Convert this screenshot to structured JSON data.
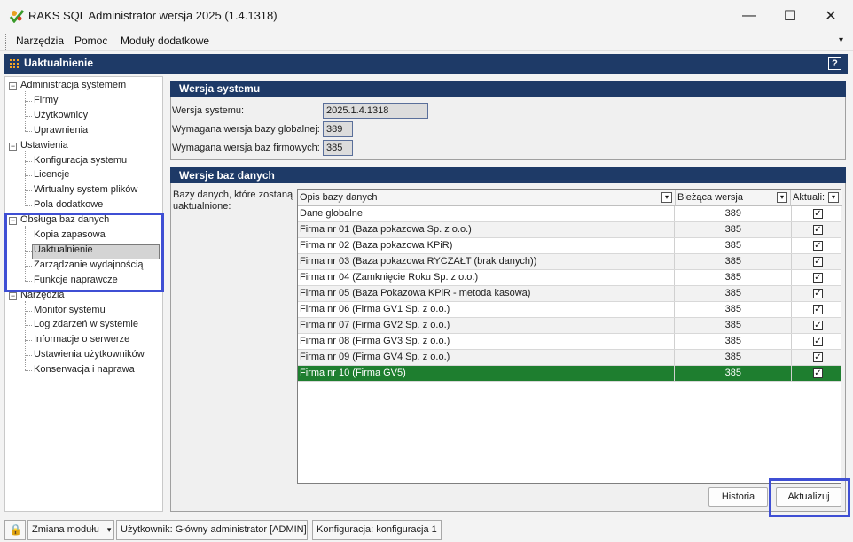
{
  "window": {
    "title": "RAKS SQL Administrator wersja 2025 (1.4.1318)",
    "minimize": "—",
    "maximize": "☐",
    "close": "✕"
  },
  "menu": {
    "items": [
      "Narzędzia",
      "Pomoc",
      "Moduły dodatkowe"
    ],
    "overflow": "▾"
  },
  "header": {
    "title": "Uaktualnienie",
    "help": "?"
  },
  "tree": [
    {
      "label": "Administracja systemem",
      "level": 0,
      "expander": "−"
    },
    {
      "label": "Firmy",
      "level": 1
    },
    {
      "label": "Użytkownicy",
      "level": 1
    },
    {
      "label": "Uprawnienia",
      "level": 1
    },
    {
      "label": "Ustawienia",
      "level": 0,
      "expander": "−"
    },
    {
      "label": "Konfiguracja systemu",
      "level": 1
    },
    {
      "label": "Licencje",
      "level": 1
    },
    {
      "label": "Wirtualny system plików",
      "level": 1
    },
    {
      "label": "Pola dodatkowe",
      "level": 1
    },
    {
      "label": "Obsługa baz danych",
      "level": 0,
      "expander": "−"
    },
    {
      "label": "Kopia zapasowa",
      "level": 1
    },
    {
      "label": "Uaktualnienie",
      "level": 1,
      "selected": true
    },
    {
      "label": "Zarządzanie wydajnością",
      "level": 1
    },
    {
      "label": "Funkcje naprawcze",
      "level": 1
    },
    {
      "label": "Narzędzia",
      "level": 0,
      "expander": "−"
    },
    {
      "label": "Monitor systemu",
      "level": 1
    },
    {
      "label": "Log zdarzeń w systemie",
      "level": 1
    },
    {
      "label": "Informacje o serwerze",
      "level": 1
    },
    {
      "label": "Ustawienia użytkowników",
      "level": 1
    },
    {
      "label": "Konserwacja i naprawa",
      "level": 1
    }
  ],
  "system_version": {
    "section_title": "Wersja systemu",
    "version_label": "Wersja systemu:",
    "version_value": "2025.1.4.1318",
    "global_label": "Wymagana wersja bazy globalnej:",
    "global_value": "389",
    "company_label": "Wymagana wersja baz firmowych:",
    "company_value": "385"
  },
  "databases": {
    "section_title": "Wersje baz danych",
    "intro": "Bazy danych, które zostaną uaktualnione:",
    "columns": [
      "Opis bazy danych",
      "Bieżąca wersja",
      "Aktuali:"
    ],
    "rows": [
      {
        "name": "Dane globalne",
        "version": "389",
        "checked": true
      },
      {
        "name": "Firma nr 01 (Baza pokazowa Sp. z o.o.)",
        "version": "385",
        "checked": true
      },
      {
        "name": "Firma nr 02 (Baza pokazowa KPiR)",
        "version": "385",
        "checked": true
      },
      {
        "name": "Firma nr 03 (Baza pokazowa RYCZAŁT (brak danych))",
        "version": "385",
        "checked": true
      },
      {
        "name": "Firma nr 04 (Zamknięcie Roku Sp. z o.o.)",
        "version": "385",
        "checked": true
      },
      {
        "name": "Firma nr 05 (Baza Pokazowa KPiR - metoda kasowa)",
        "version": "385",
        "checked": true
      },
      {
        "name": "Firma nr 06 (Firma GV1 Sp. z o.o.)",
        "version": "385",
        "checked": true
      },
      {
        "name": "Firma nr 07 (Firma GV2 Sp. z o.o.)",
        "version": "385",
        "checked": true
      },
      {
        "name": "Firma nr 08 (Firma GV3 Sp. z o.o.)",
        "version": "385",
        "checked": true
      },
      {
        "name": "Firma nr 09 (Firma GV4 Sp. z o.o.)",
        "version": "385",
        "checked": true
      },
      {
        "name": "Firma nr 10 (Firma GV5)",
        "version": "385",
        "checked": true,
        "selected": true
      }
    ],
    "check_mark": "✓",
    "dropdown_glyph": "▾"
  },
  "buttons": {
    "history": "Historia",
    "update": "Aktualizuj"
  },
  "status": {
    "lock": "🔒",
    "module": "Zmiana modułu",
    "module_arrow": "▾",
    "user": "Użytkownik: Główny administrator [ADMIN]",
    "config": "Konfiguracja: konfiguracja 1"
  },
  "colors": {
    "header_blue": "#1e3a67",
    "selected_row": "#1e7e2f",
    "highlight_frame": "#3f4fd4"
  }
}
